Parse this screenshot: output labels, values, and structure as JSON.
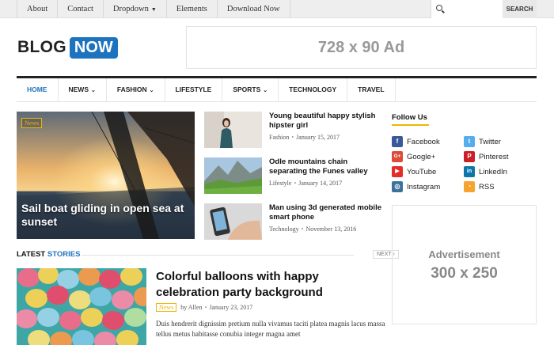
{
  "top_nav": {
    "items": [
      "About",
      "Contact",
      "Dropdown",
      "Elements",
      "Download Now"
    ],
    "search_button": "SEARCH"
  },
  "logo": {
    "part1": "BLOG",
    "part2": "NOW"
  },
  "ad_banner": "728 x 90 Ad",
  "main_nav": {
    "items": [
      "HOME",
      "NEWS",
      "FASHION",
      "LIFESTYLE",
      "SPORTS",
      "TECHNOLOGY",
      "TRAVEL"
    ]
  },
  "featured": {
    "category": "News",
    "title": "Sail boat gliding in open sea at sunset"
  },
  "side_posts": [
    {
      "title": "Young beautiful happy stylish hipster girl",
      "category": "Fashion",
      "date": "January 15, 2017"
    },
    {
      "title": "Odle mountains chain separating the Funes valley",
      "category": "Lifestyle",
      "date": "January 14, 2017"
    },
    {
      "title": "Man using 3d generated mobile smart phone",
      "category": "Technology",
      "date": "November 13, 2016"
    }
  ],
  "latest": {
    "label_part1": "LATEST",
    "label_part2": "STORIES",
    "next": "NEXT ›"
  },
  "story": {
    "title": "Colorful balloons with happy celebration party background",
    "category": "News",
    "author": "by Allen",
    "date": "January 23, 2017",
    "excerpt": "Duis hendrerit dignissim pretium nulla vivamus taciti platea magnis lacus massa tellus metus habitasse conubia integer magna amet"
  },
  "sidebar": {
    "follow_title": "Follow Us",
    "socials": [
      {
        "name": "Facebook",
        "icon": "facebook-icon",
        "glyph": "f",
        "color": "#3b5998"
      },
      {
        "name": "Twitter",
        "icon": "twitter-icon",
        "glyph": "t",
        "color": "#55acee"
      },
      {
        "name": "Google+",
        "icon": "googleplus-icon",
        "glyph": "G+",
        "color": "#dd4b39"
      },
      {
        "name": "Pinterest",
        "icon": "pinterest-icon",
        "glyph": "P",
        "color": "#cb2027"
      },
      {
        "name": "YouTube",
        "icon": "youtube-icon",
        "glyph": "▶",
        "color": "#e52d27"
      },
      {
        "name": "LinkedIn",
        "icon": "linkedin-icon",
        "glyph": "in",
        "color": "#0e76a8"
      },
      {
        "name": "Instagram",
        "icon": "instagram-icon",
        "glyph": "◎",
        "color": "#3f729b"
      },
      {
        "name": "RSS",
        "icon": "rss-icon",
        "glyph": "◔",
        "color": "#f7a330"
      }
    ],
    "ad_label": "Advertisement",
    "ad_size": "300 x 250"
  },
  "colors": {
    "brand": "#1e73be",
    "accent": "#f0b400"
  }
}
